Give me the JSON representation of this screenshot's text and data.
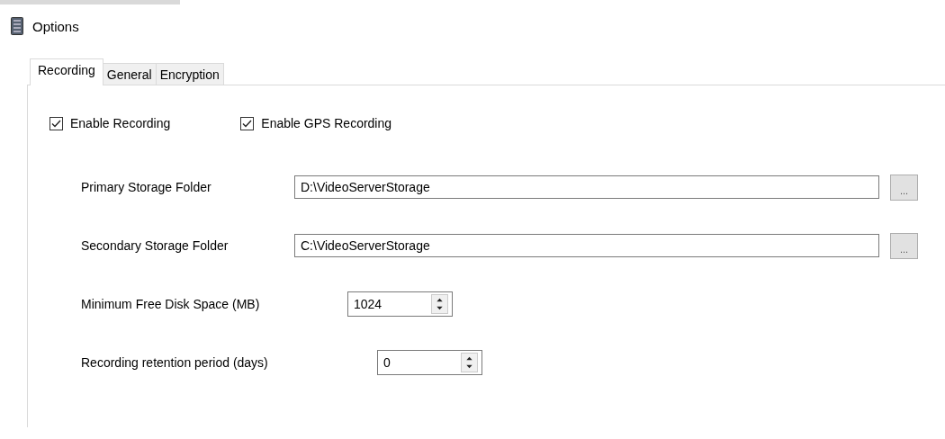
{
  "window": {
    "title": "Options"
  },
  "tabs": [
    {
      "label": "Recording",
      "selected": true
    },
    {
      "label": "General",
      "selected": false
    },
    {
      "label": "Encryption",
      "selected": false
    }
  ],
  "checkboxes": [
    {
      "label": "Enable Recording",
      "checked": true
    },
    {
      "label": "Enable GPS Recording",
      "checked": true
    }
  ],
  "fields": [
    {
      "kind": "path",
      "label": "Primary Storage Folder",
      "value": "D:\\VideoServerStorage",
      "button": "..."
    },
    {
      "kind": "path",
      "label": "Secondary Storage Folder",
      "value": "C:\\VideoServerStorage",
      "button": "..."
    },
    {
      "kind": "spin",
      "label": "Minimum Free Disk Space (MB)",
      "value": "1024"
    },
    {
      "kind": "spin",
      "label": "Recording retention period (days)",
      "value": "0"
    }
  ]
}
